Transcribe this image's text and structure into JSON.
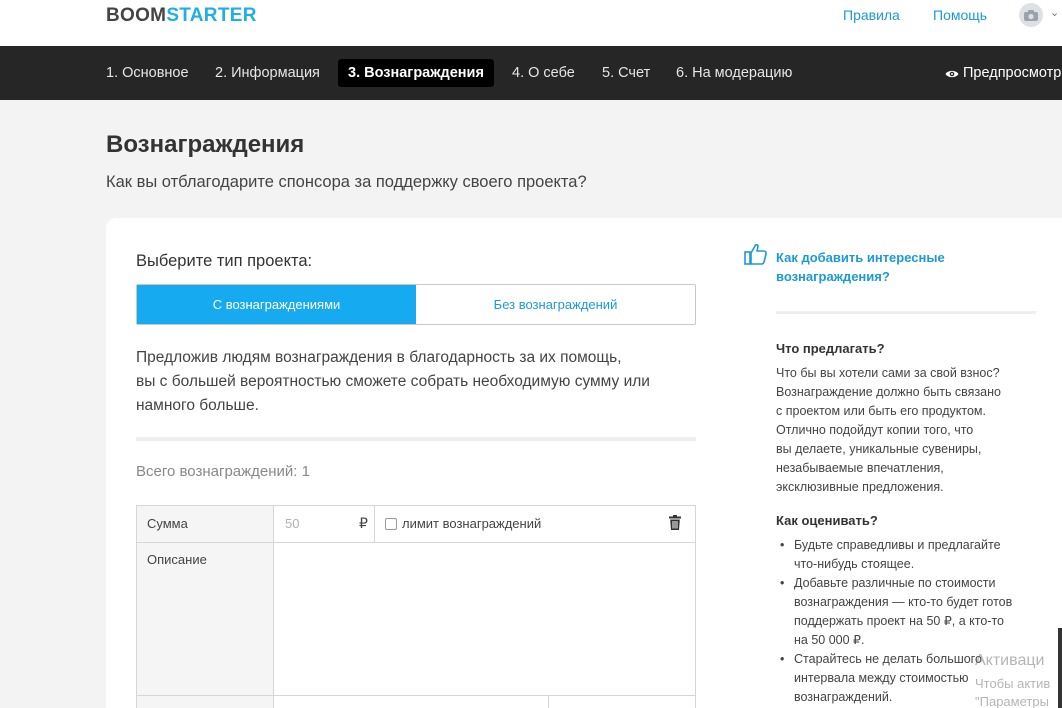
{
  "header": {
    "logo_part1": "BOOM",
    "logo_part2": "STARTER",
    "rules_link": "Правила",
    "help_link": "Помощь"
  },
  "nav": {
    "steps": [
      {
        "label": "1. Основное"
      },
      {
        "label": "2. Информация"
      },
      {
        "label": "3. Вознаграждения"
      },
      {
        "label": "4. О себе"
      },
      {
        "label": "5. Счет"
      },
      {
        "label": "6. На модерацию"
      }
    ],
    "active_index": 2,
    "preview_label": "Предпросмотр"
  },
  "page": {
    "title": "Вознаграждения",
    "subtitle": "Как вы отблагодарите спонсора за поддержку своего проекта?"
  },
  "project_type": {
    "label": "Выберите тип проекта:",
    "option_with": "С вознаграждениями",
    "option_without": "Без вознаграждений",
    "selected": "С вознаграждениями"
  },
  "description": {
    "line1": "Предложив людям вознаграждения в благодарность за их помощь,",
    "line2": "вы с большей вероятностью сможете собрать необходимую сумму или",
    "line3": "намного больше."
  },
  "rewards": {
    "total_label": "Всего вознаграждений: 1",
    "sum_label": "Сумма",
    "sum_placeholder": "50",
    "currency": "₽",
    "limit_label": "лимит вознаграждений",
    "limit_checked": false,
    "description_label": "Описание"
  },
  "sidebar": {
    "help_link": "Как добавить интересные вознаграждения?",
    "what_title": "Что предлагать?",
    "what_text": "Что бы вы хотели сами за свой взнос?\nВознаграждение должно быть связано\nс проектом или быть его продуктом.\nОтлично подойдут копии того, что\nвы делаете, уникальные сувениры,\nнезабываемые впечатления,\nэксклюзивные предложения.",
    "how_title": "Как оценивать?",
    "how_items": [
      "Будьте справедливы и предлагайте\nчто-нибудь стоящее.",
      "Добавьте различные по стоимости\nвознаграждения — кто-то будет готов\nподдержать проект на 50 ₽, а кто-то\nна 50 000 ₽.",
      "Старайтесь не делать большого\nинтервала между стоимостью\nвознаграждений."
    ]
  },
  "os_overlay": {
    "line1": "Активаци",
    "line2": "Чтобы актив",
    "line3": "\"Параметры"
  },
  "colors": {
    "accent": "#16aaf0",
    "link": "#1c9ad6",
    "nav_bg": "#262626"
  }
}
